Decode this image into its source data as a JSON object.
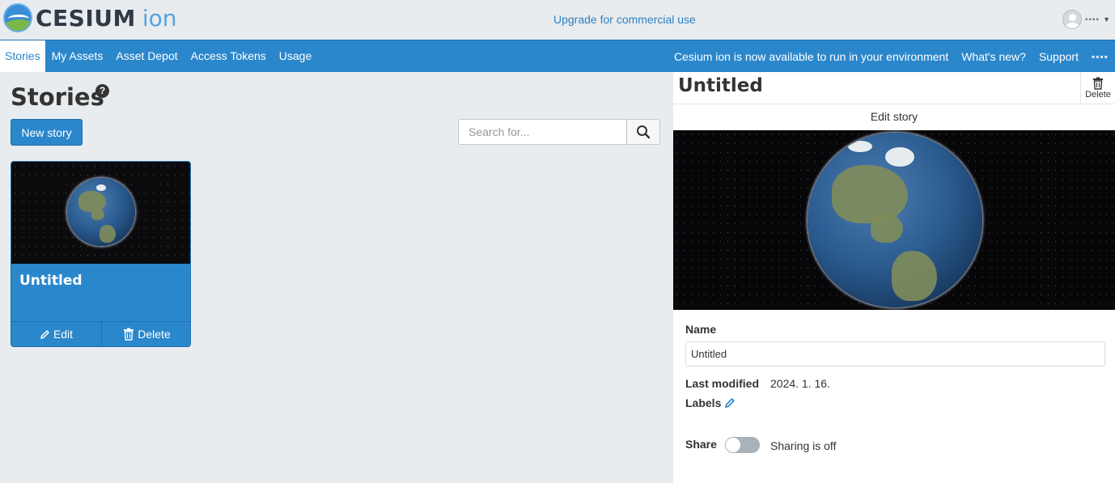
{
  "header": {
    "logo_text": "CESIUM",
    "logo_suffix": "ion",
    "upgrade_link": "Upgrade for commercial use",
    "user_name": "▪▪▪▪"
  },
  "nav": {
    "items": [
      {
        "label": "Stories",
        "active": true
      },
      {
        "label": "My Assets"
      },
      {
        "label": "Asset Depot"
      },
      {
        "label": "Access Tokens"
      },
      {
        "label": "Usage"
      }
    ],
    "announcement": "Cesium ion is now available to run in your environment",
    "whats_new": "What's new?",
    "support": "Support",
    "user": "▪▪▪▪"
  },
  "main": {
    "title": "Stories",
    "help": "?",
    "new_story_label": "New story",
    "search_placeholder": "Search for...",
    "cards": [
      {
        "title": "Untitled",
        "edit_label": "Edit",
        "delete_label": "Delete"
      }
    ]
  },
  "panel": {
    "title": "Untitled",
    "delete_label": "Delete",
    "edit_story_label": "Edit story",
    "name_label": "Name",
    "name_value": "Untitled",
    "last_modified_label": "Last modified",
    "last_modified_value": "2024. 1. 16.",
    "labels_label": "Labels",
    "share_label": "Share",
    "sharing_status": "Sharing is off"
  },
  "colors": {
    "brand_blue": "#2b87cb",
    "background": "#e8ecef",
    "link": "#2f7fc1"
  }
}
